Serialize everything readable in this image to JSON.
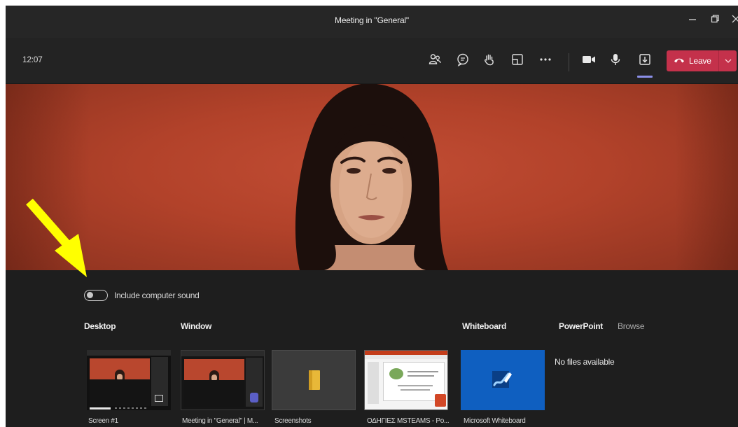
{
  "window": {
    "title": "Meeting in \"General\"",
    "controls": [
      "minimize-icon",
      "restore-icon",
      "close-icon"
    ]
  },
  "toolbar": {
    "time": "12:07",
    "icons": [
      "participants-icon",
      "chat-icon",
      "raise-hand-icon",
      "rooms-icon",
      "more-icon",
      "camera-icon",
      "microphone-icon",
      "share-icon"
    ],
    "leave_label": "Leave",
    "leave_color": "#c4314b",
    "share_active_color": "#8b8fe8"
  },
  "video": {
    "background_color": "#b2422a"
  },
  "share_tray": {
    "include_sound_label": "Include computer sound",
    "include_sound_on": false,
    "sections": {
      "desktop": "Desktop",
      "window": "Window",
      "whiteboard": "Whiteboard",
      "powerpoint": "PowerPoint",
      "browse": "Browse"
    },
    "no_files": "No files available",
    "tiles": [
      {
        "label": "Screen #1"
      },
      {
        "label": "Meeting in \"General\" | M..."
      },
      {
        "label": "Screenshots"
      },
      {
        "label": "ΟΔΗΓΙΕΣ MSTEAMS - Po..."
      },
      {
        "label": "Microsoft Whiteboard"
      }
    ]
  },
  "annotation": {
    "arrow_color": "#ffff00"
  }
}
